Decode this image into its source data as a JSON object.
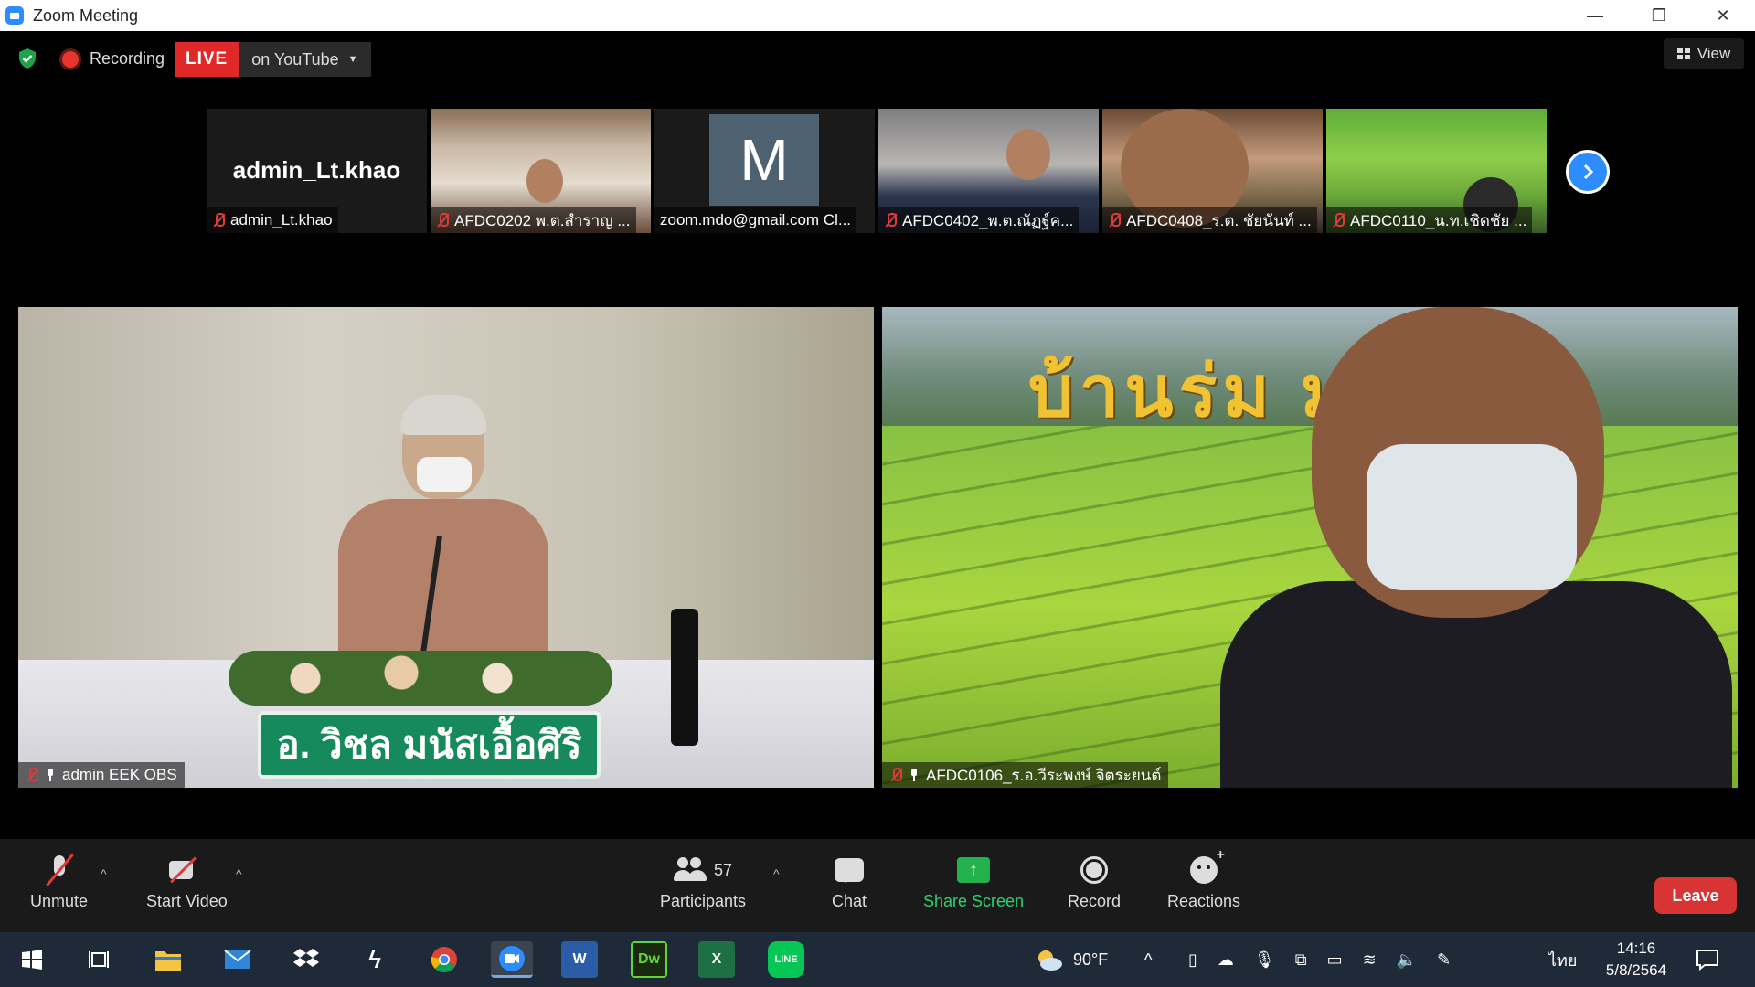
{
  "window": {
    "title": "Zoom Meeting",
    "controls": [
      "—",
      "❐",
      "✕"
    ]
  },
  "status": {
    "recording_label": "Recording",
    "live_badge": "LIVE",
    "live_destination": "on YouTube"
  },
  "view_button": "View",
  "thumbnails": [
    {
      "label": "admin_Lt.khao",
      "center_text": "admin_Lt.khao"
    },
    {
      "label": "AFDC0202 พ.ต.สำราญ ..."
    },
    {
      "label": "zoom.mdo@gmail.com Cl...",
      "avatar_letter": "M"
    },
    {
      "label": "AFDC0402_พ.ต.ณัฏฐ์ค..."
    },
    {
      "label": "AFDC0408_ร.ต. ชัยนันท์ ..."
    },
    {
      "label": "AFDC0110_น.ท.เชิดชัย ..."
    }
  ],
  "videos": {
    "left": {
      "label": "admin EEK OBS",
      "nameplate": "อ. วิชล  มนัสเอื้อศิริ"
    },
    "right": {
      "label": "AFDC0106_ร.อ.วีระพงษ์ จิตระยนต์",
      "background_text": "บ้านร่ม  มนา"
    }
  },
  "toolbar": {
    "unmute": "Unmute",
    "start_video": "Start Video",
    "participants": "Participants",
    "participant_count": "57",
    "chat": "Chat",
    "share_screen": "Share Screen",
    "record": "Record",
    "reactions": "Reactions",
    "leave": "Leave"
  },
  "taskbar": {
    "weather": "90°F",
    "language": "ไทย",
    "time": "14:16",
    "date": "5/8/2564"
  },
  "colors": {
    "live_red": "#e02828",
    "zoom_blue": "#2d8cff",
    "share_green": "#22b14c",
    "leave_red": "#d93434"
  }
}
